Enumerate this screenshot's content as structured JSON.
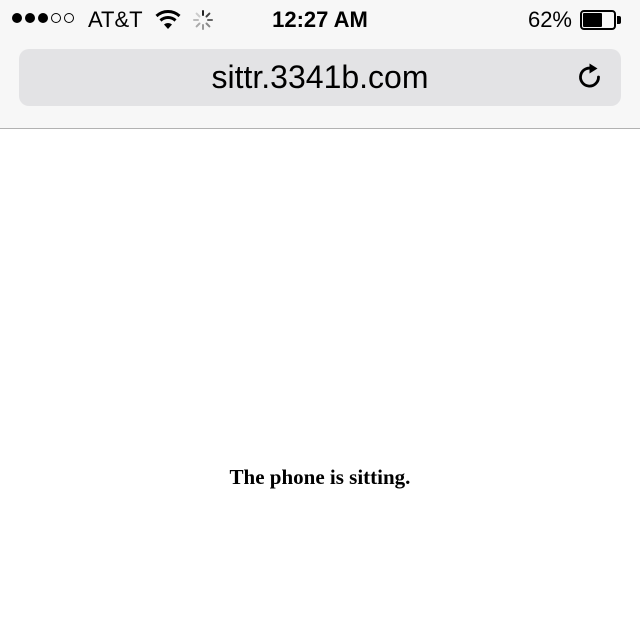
{
  "status_bar": {
    "signal_strength": 3,
    "signal_max": 5,
    "carrier": "AT&T",
    "wifi_icon": "wifi-icon",
    "activity_icon": "loading-spinner-icon",
    "time": "12:27 AM",
    "battery_percent_label": "62%",
    "battery_level": 0.62
  },
  "address_bar": {
    "url": "sittr.3341b.com",
    "reload_icon": "reload-icon"
  },
  "page": {
    "message": "The phone is sitting."
  }
}
